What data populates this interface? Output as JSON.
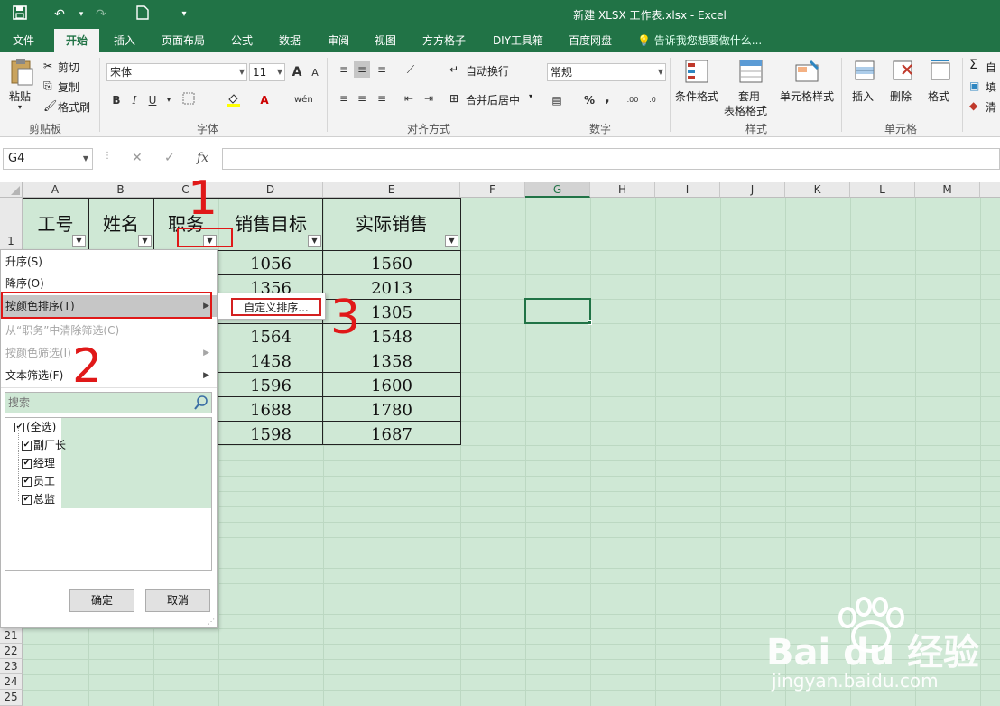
{
  "window": {
    "title": "新建 XLSX 工作表.xlsx - Excel",
    "quick_access_icons": [
      "save-icon",
      "undo-icon",
      "redo-icon",
      "new-file-icon",
      "customize-icon"
    ]
  },
  "tabs": [
    "文件",
    "开始",
    "插入",
    "页面布局",
    "公式",
    "数据",
    "审阅",
    "视图",
    "方方格子",
    "DIY工具箱",
    "百度网盘"
  ],
  "active_tab": "开始",
  "tell_me": "告诉我您想要做什么...",
  "ribbon": {
    "clipboard": {
      "paste": "粘贴",
      "cut": "剪切",
      "copy": "复制",
      "format_painter": "格式刷",
      "label": "剪贴板"
    },
    "font": {
      "name": "宋体",
      "size": "11",
      "bold": "B",
      "italic": "I",
      "underline": "U",
      "grow": "A",
      "shrink": "A",
      "phonetic": "wén",
      "label": "字体"
    },
    "alignment": {
      "wrap": "自动换行",
      "merge": "合并后居中",
      "label": "对齐方式"
    },
    "number": {
      "format": "常规",
      "percent": "%",
      "comma": ",",
      "label": "数字"
    },
    "styles": {
      "conditional": "条件格式",
      "table_1": "套用",
      "table_2": "表格格式",
      "cell_styles": "单元格样式",
      "label": "样式"
    },
    "cells": {
      "insert": "插入",
      "delete": "删除",
      "format": "格式",
      "label": "单元格"
    },
    "editing": {
      "autosum": "自",
      "fill": "填",
      "clear": "清"
    }
  },
  "formula_bar": {
    "name_box": "G4",
    "fx": "fx",
    "cancel": "✕",
    "confirm": "✓",
    "value": ""
  },
  "columns": [
    "A",
    "B",
    "C",
    "D",
    "E",
    "F",
    "G",
    "H",
    "I",
    "J",
    "K",
    "L",
    "M"
  ],
  "selected_column": "G",
  "visible_row_numbers_bottom": [
    "21",
    "22",
    "23",
    "24",
    "25"
  ],
  "row1_label": "1",
  "table": {
    "headers": [
      "工号",
      "姓名",
      "职务",
      "销售目标",
      "实际销售"
    ],
    "sales_target": [
      "1056",
      "1356",
      "",
      "1564",
      "1458",
      "1596",
      "1688",
      "1598"
    ],
    "actual_sales": [
      "1560",
      "2013",
      "1305",
      "1548",
      "1358",
      "1600",
      "1780",
      "1687"
    ]
  },
  "filter_menu": {
    "sort_asc": "升序(S)",
    "sort_desc": "降序(O)",
    "sort_by_color": "按颜色排序(T)",
    "clear_filter": "从“职务”中清除筛选(C)",
    "filter_by_color": "按颜色筛选(I)",
    "text_filter": "文本筛选(F)",
    "search_placeholder": "搜索",
    "items": [
      "(全选)",
      "副厂长",
      "经理",
      "员工",
      "总监"
    ],
    "ok": "确定",
    "cancel": "取消"
  },
  "submenu": {
    "custom_sort": "自定义排序..."
  },
  "annotations": [
    "1",
    "2",
    "3"
  ],
  "watermark": {
    "brand": "Bai du 经验",
    "url": "jingyan.baidu.com"
  },
  "colors": {
    "excel_green": "#217346",
    "sheet_bg": "#cfe8d5",
    "annotation_red": "#e01818"
  }
}
